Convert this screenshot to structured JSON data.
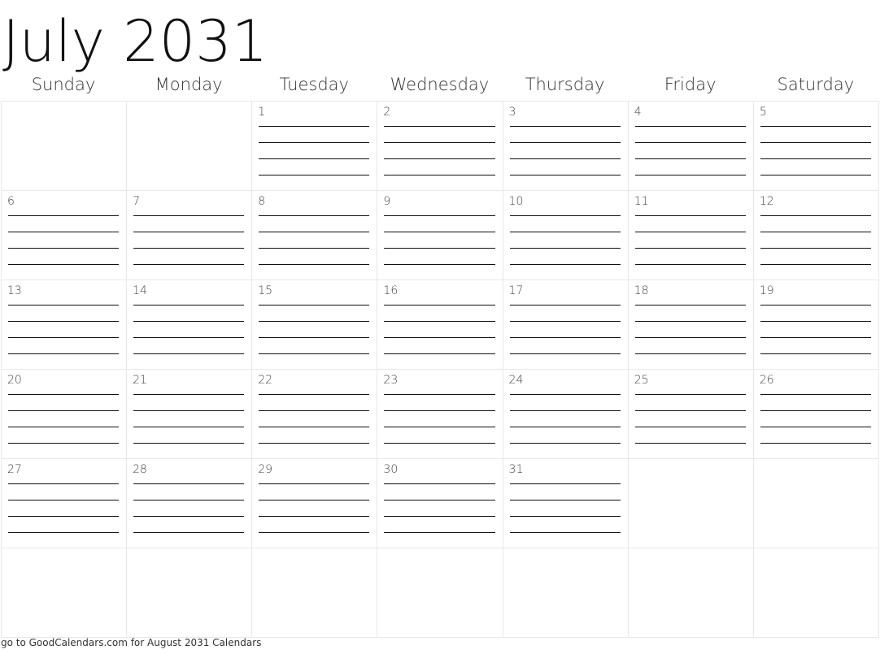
{
  "title": "July 2031",
  "weekdays": [
    "Sunday",
    "Monday",
    "Tuesday",
    "Wednesday",
    "Thursday",
    "Friday",
    "Saturday"
  ],
  "weeks": [
    [
      "",
      "",
      "1",
      "2",
      "3",
      "4",
      "5"
    ],
    [
      "6",
      "7",
      "8",
      "9",
      "10",
      "11",
      "12"
    ],
    [
      "13",
      "14",
      "15",
      "16",
      "17",
      "18",
      "19"
    ],
    [
      "20",
      "21",
      "22",
      "23",
      "24",
      "25",
      "26"
    ],
    [
      "27",
      "28",
      "29",
      "30",
      "31",
      "",
      ""
    ],
    [
      "",
      "",
      "",
      "",
      "",
      "",
      ""
    ]
  ],
  "lines_per_day": 4,
  "footer": "go to GoodCalendars.com for August 2031 Calendars"
}
